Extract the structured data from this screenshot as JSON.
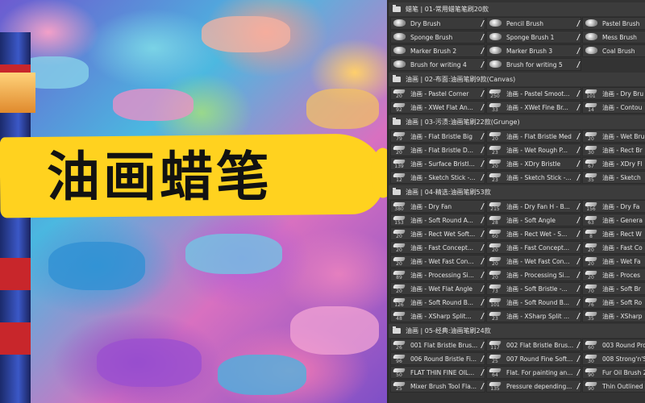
{
  "banner": {
    "title": "油画蜡笔"
  },
  "groups": [
    {
      "header": "蜡笔 | 01-常用蜡笔笔刷20款",
      "rows": [
        [
          {
            "name": "Dry Brush",
            "size": ""
          },
          {
            "name": "Pencil Brush",
            "size": ""
          },
          {
            "name": "Pastel Brush",
            "size": ""
          }
        ],
        [
          {
            "name": "Sponge Brush",
            "size": ""
          },
          {
            "name": "Sponge Brush 1",
            "size": ""
          },
          {
            "name": "Mess Brush",
            "size": ""
          }
        ],
        [
          {
            "name": "Marker Brush 2",
            "size": ""
          },
          {
            "name": "Marker Brush 3",
            "size": ""
          },
          {
            "name": "Coal Brush",
            "size": ""
          }
        ],
        [
          {
            "name": "Brush for writing 4",
            "size": ""
          },
          {
            "name": "Brush for writing 5",
            "size": ""
          }
        ]
      ]
    },
    {
      "header": "油画 | 02-布面:油画笔刷9款(Canvas)",
      "rows": [
        [
          {
            "name": "油画 - Pastel Corner",
            "size": "20"
          },
          {
            "name": "油画 - Pastel Smoot...",
            "size": "250"
          },
          {
            "name": "油画 - Dry Bru",
            "size": "101"
          }
        ],
        [
          {
            "name": "油画 - XWet Flat An...",
            "size": "92"
          },
          {
            "name": "油画 - XWet Fine Br...",
            "size": "33"
          },
          {
            "name": "油画 - Contou",
            "size": "14"
          }
        ]
      ]
    },
    {
      "header": "油画 | 03-污渍:油画笔刷22款(Grunge)",
      "rows": [
        [
          {
            "name": "油画 - Flat Bristle Big",
            "size": "79"
          },
          {
            "name": "油画 - Flat Bristle Med",
            "size": "20"
          },
          {
            "name": "油画 - Wet Bru",
            "size": "20"
          }
        ],
        [
          {
            "name": "油画 - Flat Bristle D...",
            "size": "20"
          },
          {
            "name": "油画 - Wet Rough P...",
            "size": "23"
          },
          {
            "name": "油画 - Rect Br",
            "size": "30"
          }
        ],
        [
          {
            "name": "油画 - Surface Bristl...",
            "size": "139"
          },
          {
            "name": "油画 - XDry Bristle",
            "size": "20"
          },
          {
            "name": "油画 - XDry Fl",
            "size": "67"
          }
        ],
        [
          {
            "name": "油画 - Sketch Stick -...",
            "size": "12"
          },
          {
            "name": "油画 - Sketch Stick -...",
            "size": "23"
          },
          {
            "name": "油画 - Sketch",
            "size": "35"
          }
        ]
      ]
    },
    {
      "header": "油画 | 04-精选:油画笔刷53款",
      "rows": [
        [
          {
            "name": "油画 - Dry Fan",
            "size": "380"
          },
          {
            "name": "油画 - Dry Fan H - B...",
            "size": "215"
          },
          {
            "name": "油画 - Dry Fa",
            "size": "156"
          }
        ],
        [
          {
            "name": "油画 - Soft Round A...",
            "size": "153"
          },
          {
            "name": "油画 - Soft Angle",
            "size": "28"
          },
          {
            "name": "油画 - Genera",
            "size": "63"
          }
        ],
        [
          {
            "name": "油画 - Rect Wet Soft...",
            "size": "20"
          },
          {
            "name": "油画 - Rect Wet - S...",
            "size": "60"
          },
          {
            "name": "油画 - Rect W",
            "size": "8"
          }
        ],
        [
          {
            "name": "油画 - Fast Concept...",
            "size": "20"
          },
          {
            "name": "油画 - Fast Concept...",
            "size": "20"
          },
          {
            "name": "油画 - Fast Co",
            "size": "20"
          }
        ],
        [
          {
            "name": "油画 - Wet Fast Con...",
            "size": "20"
          },
          {
            "name": "油画 - Wet Fast Con...",
            "size": "20"
          },
          {
            "name": "油画 - Wet Fa",
            "size": "20"
          }
        ],
        [
          {
            "name": "油画 - Processing Si...",
            "size": "89"
          },
          {
            "name": "油画 - Processing Si...",
            "size": "20"
          },
          {
            "name": "油画 - Proces",
            "size": "20"
          }
        ],
        [
          {
            "name": "油画 - Wet Flat Angle",
            "size": "20"
          },
          {
            "name": "油画 - Soft Bristle -...",
            "size": "73"
          },
          {
            "name": "油画 - Soft Br",
            "size": "70"
          }
        ],
        [
          {
            "name": "油画 - Soft Round B...",
            "size": "126"
          },
          {
            "name": "油画 - Soft Round B...",
            "size": "101"
          },
          {
            "name": "油画 - Soft Ro",
            "size": "76"
          }
        ],
        [
          {
            "name": "油画 - XSharp Split...",
            "size": "48"
          },
          {
            "name": "油画 - XSharp Split ...",
            "size": "23"
          },
          {
            "name": "油画 - XSharp",
            "size": "35"
          }
        ]
      ]
    },
    {
      "header": "油画 | 05-经典:油画笔刷24款",
      "rows": [
        [
          {
            "name": "001 Flat Bristle Brus...",
            "size": "26"
          },
          {
            "name": "002 Flat Bristle Brus...",
            "size": "117"
          },
          {
            "name": "003 Round Pro",
            "size": "60"
          }
        ],
        [
          {
            "name": "006 Round Bristle Fi...",
            "size": "96"
          },
          {
            "name": "007 Round Fine Soft...",
            "size": "25"
          },
          {
            "name": "008 Strong'n'S",
            "size": "30"
          }
        ],
        [
          {
            "name": "FLAT THIN FINE OIL...",
            "size": "50"
          },
          {
            "name": "Flat. For painting an...",
            "size": "64"
          },
          {
            "name": "Fur Oil Brush 2",
            "size": "90"
          }
        ],
        [
          {
            "name": "Mixer Brush Tool Fla...",
            "size": "25"
          },
          {
            "name": "Pressure depending...",
            "size": "135"
          },
          {
            "name": "Thin Outlined",
            "size": "90"
          }
        ]
      ]
    }
  ]
}
